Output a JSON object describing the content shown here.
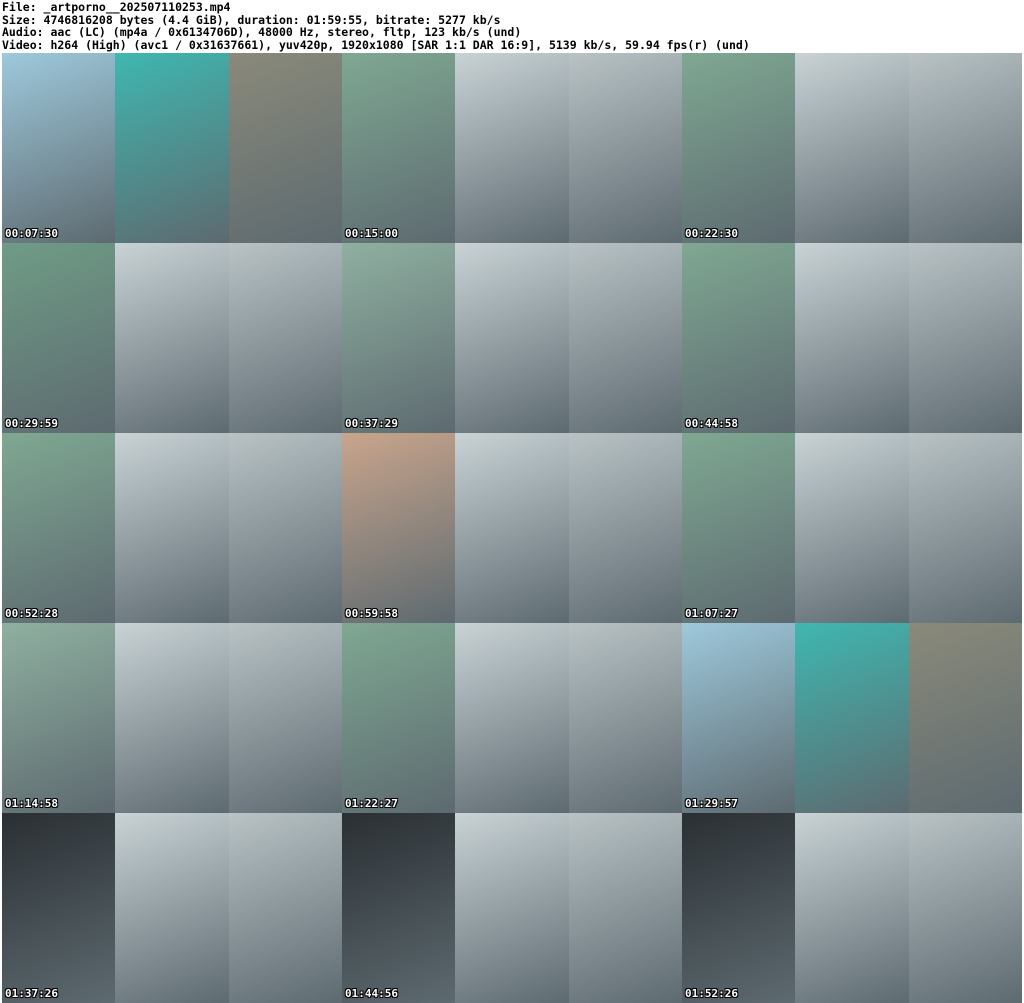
{
  "header": {
    "file": "File: _artporno__202507110253.mp4",
    "size": "Size: 4746816208 bytes (4.4 GiB), duration: 01:59:55, bitrate: 5277 kb/s",
    "audio": "Audio: aac (LC) (mp4a / 0x6134706D), 48000 Hz, stereo, fltp, 123 kb/s (und)",
    "video": "Video: h264 (High) (avc1 / 0x31637661), yuv420p, 1920x1080 [SAR 1:1 DAR 16:9], 5139 kb/s, 59.94 fps(r) (und)"
  },
  "thumbnails": [
    {
      "timestamp": "00:07:30",
      "colors": [
        "#9ec9dc",
        "#3fb7b0",
        "#8a8a7a"
      ]
    },
    {
      "timestamp": "00:15:00",
      "colors": [
        "#7fa892",
        "#c9d3d6",
        "#b9c3c6"
      ]
    },
    {
      "timestamp": "00:22:30",
      "colors": [
        "#7fa892",
        "#c9d3d6",
        "#b9c3c6"
      ]
    },
    {
      "timestamp": "00:29:59",
      "colors": [
        "#6f9c86",
        "#c9d3d6",
        "#b9c3c6"
      ]
    },
    {
      "timestamp": "00:37:29",
      "colors": [
        "#8fb0a0",
        "#c9d3d6",
        "#b9c3c6"
      ]
    },
    {
      "timestamp": "00:44:58",
      "colors": [
        "#7fa892",
        "#c9d3d6",
        "#b9c3c6"
      ]
    },
    {
      "timestamp": "00:52:28",
      "colors": [
        "#7fa892",
        "#c9d3d6",
        "#b9c3c6"
      ]
    },
    {
      "timestamp": "00:59:58",
      "colors": [
        "#c9a58c",
        "#c9d3d6",
        "#b9c3c6"
      ]
    },
    {
      "timestamp": "01:07:27",
      "colors": [
        "#7fa892",
        "#c9d3d6",
        "#b9c3c6"
      ]
    },
    {
      "timestamp": "01:14:58",
      "colors": [
        "#8fb0a0",
        "#c9d3d6",
        "#b9c3c6"
      ]
    },
    {
      "timestamp": "01:22:27",
      "colors": [
        "#7fa892",
        "#c9d3d6",
        "#b9c3c6"
      ]
    },
    {
      "timestamp": "01:29:57",
      "colors": [
        "#9ec9dc",
        "#3fb7b0",
        "#8a8a7a"
      ]
    },
    {
      "timestamp": "01:37:26",
      "colors": [
        "#2a2f33",
        "#c9d3d6",
        "#b9c3c6"
      ]
    },
    {
      "timestamp": "01:44:56",
      "colors": [
        "#2a2f33",
        "#c9d3d6",
        "#b9c3c6"
      ]
    },
    {
      "timestamp": "01:52:26",
      "colors": [
        "#2a2f33",
        "#c9d3d6",
        "#b9c3c6"
      ]
    }
  ]
}
